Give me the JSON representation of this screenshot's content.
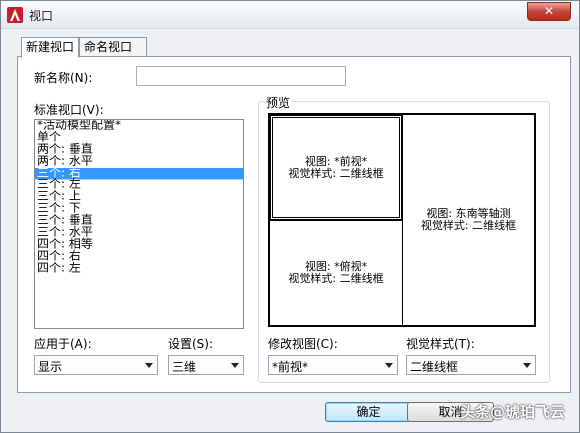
{
  "window": {
    "title": "视口",
    "close_symbol": "✕"
  },
  "tabs": [
    {
      "label": "新建视口",
      "active": true
    },
    {
      "label": "命名视口",
      "active": false
    }
  ],
  "new_name": {
    "label": "新名称(N):",
    "value": ""
  },
  "standard_viewports": {
    "label": "标准视口(V):",
    "items": [
      "*活动模型配置*",
      "单个",
      "两个: 垂直",
      "两个: 水平",
      "三个: 右",
      "三个: 左",
      "三个: 上",
      "三个: 下",
      "三个: 垂直",
      "三个: 水平",
      "四个: 相等",
      "四个: 右",
      "四个: 左"
    ],
    "selected_index": 4
  },
  "preview": {
    "label": "预览",
    "top_left": {
      "view": "视图: *前视*",
      "style": "视觉样式: 二维线框"
    },
    "bottom_left": {
      "view": "视图: *俯视*",
      "style": "视觉样式: 二维线框"
    },
    "right": {
      "view": "视图: 东南等轴测",
      "style": "视觉样式: 二维线框"
    }
  },
  "apply_to": {
    "label": "应用于(A):",
    "value": "显示"
  },
  "setup": {
    "label": "设置(S):",
    "value": "三维"
  },
  "change_view": {
    "label": "修改视图(C):",
    "value": "*前视*"
  },
  "visual_style": {
    "label": "视觉样式(T):",
    "value": "二维线框"
  },
  "buttons": {
    "ok": "确定",
    "cancel": "取消"
  },
  "watermark": "头条@琥珀飞云",
  "colors": {
    "selection": "#3399ff",
    "close_button": "#c7463a"
  }
}
